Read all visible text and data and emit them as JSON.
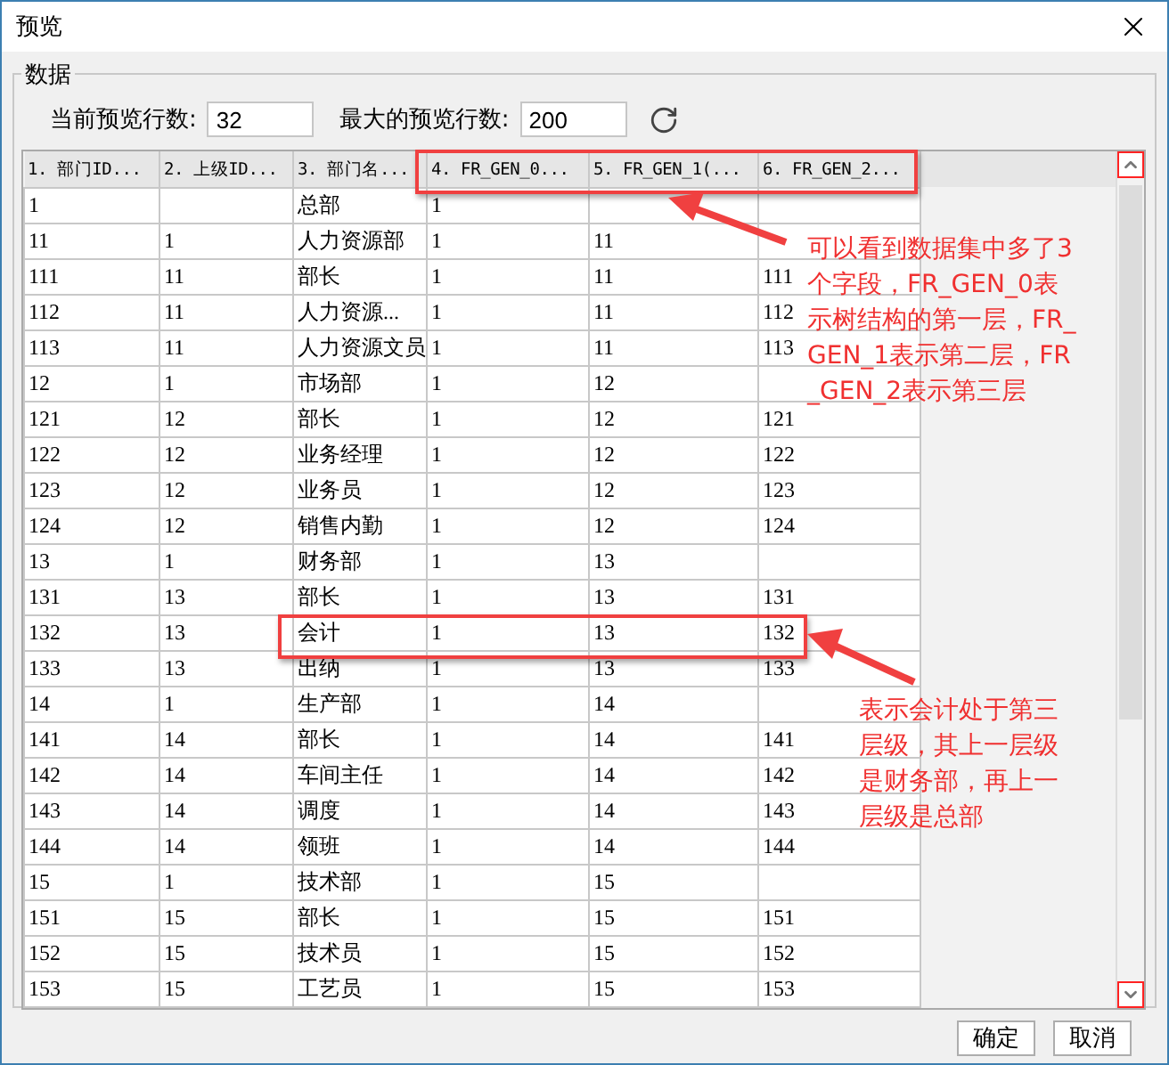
{
  "window": {
    "title": "预览"
  },
  "group": {
    "title": "数据"
  },
  "fields": [
    {
      "label": "当前预览行数:",
      "value": "32"
    },
    {
      "label": "最大的预览行数:",
      "value": "200"
    }
  ],
  "columns": [
    "1. 部门ID...",
    "2. 上级ID...",
    "3. 部门名...",
    "4. FR_GEN_0...",
    "5. FR_GEN_1(...",
    "6. FR_GEN_2..."
  ],
  "rows": [
    [
      "1",
      "",
      "总部",
      "1",
      "",
      ""
    ],
    [
      "11",
      "1",
      "人力资源部",
      "1",
      "11",
      ""
    ],
    [
      "111",
      "11",
      "部长",
      "1",
      "11",
      "111"
    ],
    [
      "112",
      "11",
      "人力资源...",
      "1",
      "11",
      "112"
    ],
    [
      "113",
      "11",
      "人力资源文员",
      "1",
      "11",
      "113"
    ],
    [
      "12",
      "1",
      "市场部",
      "1",
      "12",
      ""
    ],
    [
      "121",
      "12",
      "部长",
      "1",
      "12",
      "121"
    ],
    [
      "122",
      "12",
      "业务经理",
      "1",
      "12",
      "122"
    ],
    [
      "123",
      "12",
      "业务员",
      "1",
      "12",
      "123"
    ],
    [
      "124",
      "12",
      "销售内勤",
      "1",
      "12",
      "124"
    ],
    [
      "13",
      "1",
      "财务部",
      "1",
      "13",
      ""
    ],
    [
      "131",
      "13",
      "部长",
      "1",
      "13",
      "131"
    ],
    [
      "132",
      "13",
      "会计",
      "1",
      "13",
      "132"
    ],
    [
      "133",
      "13",
      "出纳",
      "1",
      "13",
      "133"
    ],
    [
      "14",
      "1",
      "生产部",
      "1",
      "14",
      ""
    ],
    [
      "141",
      "14",
      "部长",
      "1",
      "14",
      "141"
    ],
    [
      "142",
      "14",
      "车间主任",
      "1",
      "14",
      "142"
    ],
    [
      "143",
      "14",
      "调度",
      "1",
      "14",
      "143"
    ],
    [
      "144",
      "14",
      "领班",
      "1",
      "14",
      "144"
    ],
    [
      "15",
      "1",
      "技术部",
      "1",
      "15",
      ""
    ],
    [
      "151",
      "15",
      "部长",
      "1",
      "15",
      "151"
    ],
    [
      "152",
      "15",
      "技术员",
      "1",
      "15",
      "152"
    ],
    [
      "153",
      "15",
      "工艺员",
      "1",
      "15",
      "153"
    ]
  ],
  "annotations": [
    {
      "text": "可以看到数据集中多了3个字段，FR_GEN_0表示树结构的第一层，FR_GEN_1表示第二层，FR_GEN_2表示第三层"
    },
    {
      "text": "表示会计处于第三层级，其上一层级是财务部，再上一层级是总部"
    }
  ],
  "buttons": [
    "确定",
    "取消"
  ]
}
